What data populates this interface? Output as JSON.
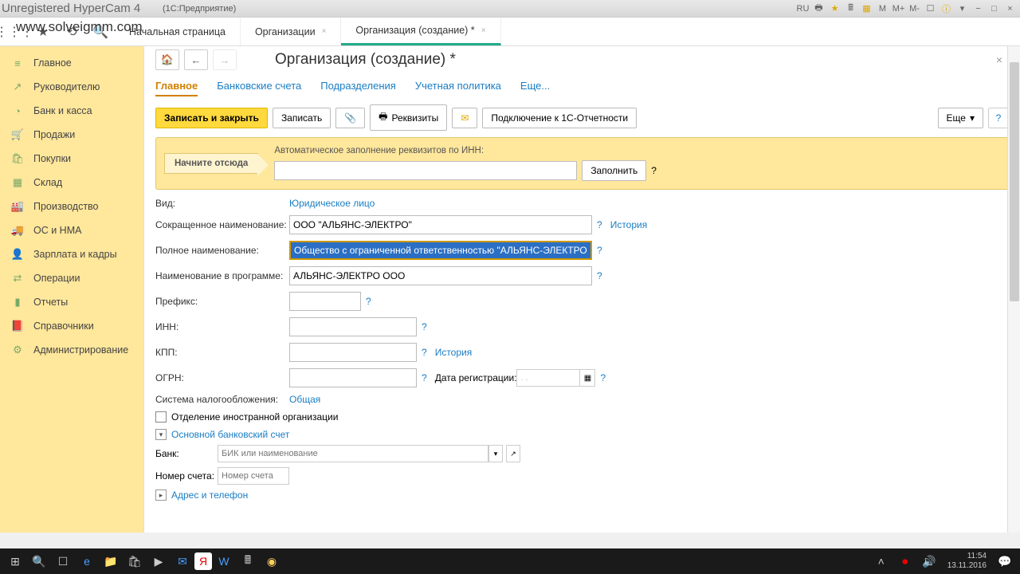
{
  "watermark1": "Unregistered HyperCam 4",
  "watermark2": "www.solveigmm.com",
  "titlebar": {
    "text": "(1С:Предприятие)",
    "lang": "RU"
  },
  "tabs": [
    {
      "label": "Начальная страница"
    },
    {
      "label": "Организации"
    },
    {
      "label": "Организация (создание) *"
    }
  ],
  "sidebar": [
    {
      "icon": "≡",
      "label": "Главное"
    },
    {
      "icon": "↗",
      "label": "Руководителю"
    },
    {
      "icon": "◔",
      "label": "Банк и касса"
    },
    {
      "icon": "🛒",
      "label": "Продажи"
    },
    {
      "icon": "🛍",
      "label": "Покупки"
    },
    {
      "icon": "▦",
      "label": "Склад"
    },
    {
      "icon": "🏭",
      "label": "Производство"
    },
    {
      "icon": "🚚",
      "label": "ОС и НМА"
    },
    {
      "icon": "👤",
      "label": "Зарплата и кадры"
    },
    {
      "icon": "⇄",
      "label": "Операции"
    },
    {
      "icon": "▮",
      "label": "Отчеты"
    },
    {
      "icon": "📕",
      "label": "Справочники"
    },
    {
      "icon": "⚙",
      "label": "Администрирование"
    }
  ],
  "page": {
    "title": "Организация (создание) *",
    "subtabs": [
      "Главное",
      "Банковские счета",
      "Подразделения",
      "Учетная политика",
      "Еще..."
    ],
    "actions": {
      "save_close": "Записать и закрыть",
      "save": "Записать",
      "requisites": "Реквизиты",
      "connect": "Подключение к 1С-Отчетности",
      "more": "Еще"
    },
    "start": {
      "label": "Начните отсюда",
      "hint": "Автоматическое заполнение реквизитов по ИНН:",
      "fill": "Заполнить"
    },
    "fields": {
      "kind_label": "Вид:",
      "kind_value": "Юридическое лицо",
      "short_label": "Сокращенное наименование:",
      "short_value": "ООО \"АЛЬЯНС-ЭЛЕКТРО\"",
      "full_label": "Полное наименование:",
      "full_value": "Общество с ограниченной ответственностью \"АЛЬЯНС-ЭЛЕКТРО\"",
      "prog_label": "Наименование в программе:",
      "prog_value": "АЛЬЯНС-ЭЛЕКТРО ООО",
      "prefix_label": "Префикс:",
      "inn_label": "ИНН:",
      "kpp_label": "КПП:",
      "ogrn_label": "ОГРН:",
      "reg_date_label": "Дата регистрации:",
      "reg_date_placeholder": ". .",
      "tax_label": "Система налогообложения:",
      "tax_value": "Общая",
      "foreign_label": "Отделение иностранной организации",
      "history": "История"
    },
    "expanders": {
      "bank": "Основной банковский счет",
      "address": "Адрес и телефон"
    },
    "bank": {
      "bank_label": "Банк:",
      "bank_placeholder": "БИК или наименование",
      "acct_label": "Номер счета:",
      "acct_placeholder": "Номер счета"
    }
  },
  "taskbar": {
    "time": "11:54",
    "date": "13.11.2016"
  }
}
